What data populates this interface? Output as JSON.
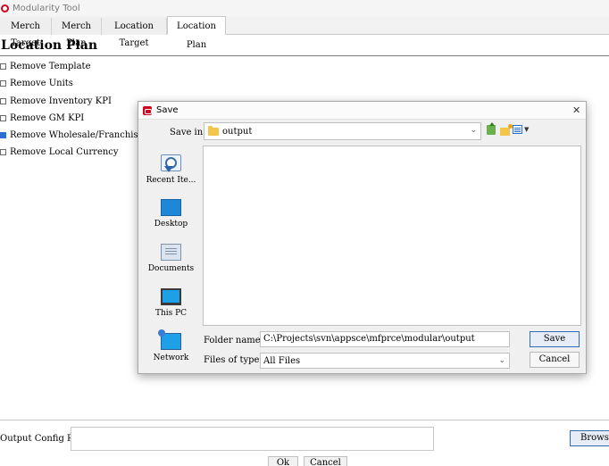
{
  "window": {
    "title": "Modularity Tool"
  },
  "tabs": [
    {
      "label": "Merch Target",
      "active": false
    },
    {
      "label": "Merch Plan",
      "active": false
    },
    {
      "label": "Location Target",
      "active": false
    },
    {
      "label": "Location Plan",
      "active": true
    }
  ],
  "plan": {
    "title": "Location Plan",
    "options": [
      {
        "label": "Remove Template",
        "checked": false
      },
      {
        "label": "Remove Units",
        "checked": false
      },
      {
        "label": "Remove Inventory KPI",
        "checked": false
      },
      {
        "label": "Remove GM KPI",
        "checked": false
      },
      {
        "label": "Remove Wholesale/Franchise KPI",
        "checked": true
      },
      {
        "label": "Remove Local Currency",
        "checked": false
      }
    ]
  },
  "output": {
    "label": "Output Config Path",
    "value": "",
    "browse_label": "Browse",
    "ok_label": "Ok",
    "cancel_label": "Cancel"
  },
  "dialog": {
    "title": "Save",
    "close_glyph": "✕",
    "save_in_label": "Save in:",
    "save_in_value": "output",
    "places": [
      {
        "label": "Recent Ite...",
        "icon": "recent-items-icon"
      },
      {
        "label": "Desktop",
        "icon": "desktop-icon"
      },
      {
        "label": "Documents",
        "icon": "documents-icon"
      },
      {
        "label": "This PC",
        "icon": "this-pc-icon"
      },
      {
        "label": "Network",
        "icon": "network-icon"
      }
    ],
    "folder_name_label": "Folder name:",
    "folder_name_value": "C:\\Projects\\svn\\appsce\\mfprce\\modular\\output",
    "files_of_type_label": "Files of type:",
    "files_of_type_value": "All Files",
    "save_label": "Save",
    "cancel_label": "Cancel"
  },
  "colors": {
    "accent": "#2e6db4",
    "check": "#2a6fd6",
    "brand": "#d0021b"
  }
}
